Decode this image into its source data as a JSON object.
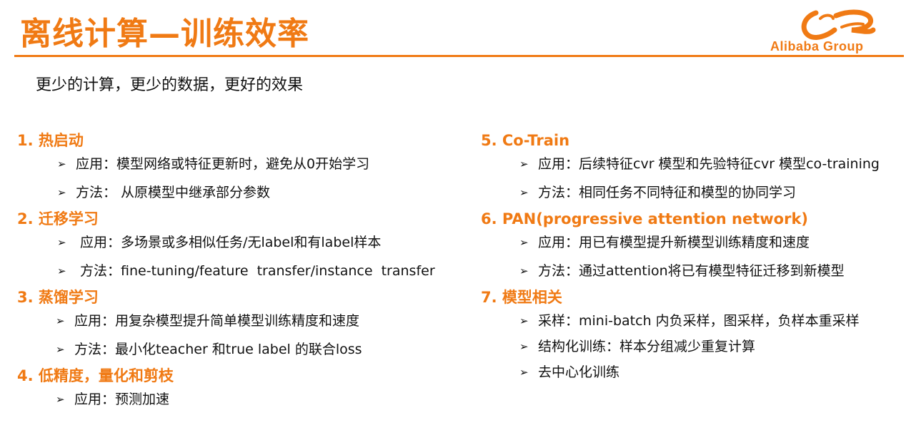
{
  "header": {
    "title": "离线计算—训练效率",
    "logo_text": "Alibaba Group",
    "accent_color": "#f07a14"
  },
  "subtitle": "更少的计算，更少的数据，更好的效果",
  "columns": [
    {
      "sections": [
        {
          "heading": "1. 热启动",
          "items": [
            "应用：模型网络或特征更新时，避免从0开始学习",
            "方法： 从原模型中继承部分参数"
          ]
        },
        {
          "heading": "2. 迁移学习",
          "items": [
            " 应用：多场景或多相似任务/无label和有label样本",
            " 方法：fine-tuning/feature  transfer/instance  transfer"
          ]
        },
        {
          "heading": "3. 蒸馏学习",
          "items": [
            "应用：用复杂模型提升简单模型训练精度和速度",
            "方法：最小化teacher 和true label 的联合loss"
          ]
        },
        {
          "heading": "4. 低精度，量化和剪枝",
          "items": [
            "应用：预测加速"
          ]
        }
      ]
    },
    {
      "sections": [
        {
          "heading": "5. Co-Train",
          "items": [
            "应用：后续特征cvr 模型和先验特征cvr 模型co-training",
            "方法：相同任务不同特征和模型的协同学习"
          ]
        },
        {
          "heading": "6. PAN(progressive  attention  network)",
          "items": [
            "应用：用已有模型提升新模型训练精度和速度",
            "方法：通过attention将已有模型特征迁移到新模型"
          ]
        },
        {
          "heading": "7. 模型相关",
          "items": [
            "采样：mini-batch 内负采样，图采样，负样本重采样",
            "结构化训练：样本分组减少重复计算",
            "去中心化训练"
          ]
        }
      ]
    }
  ],
  "icons": {
    "bullet": "arrowhead-bullet-icon",
    "logo": "alibaba-smile-logo-icon"
  }
}
